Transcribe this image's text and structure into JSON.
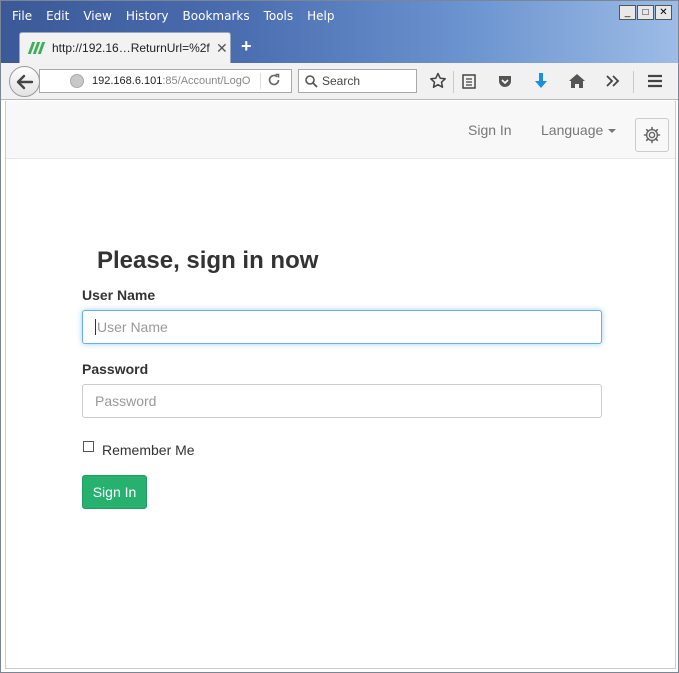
{
  "browser": {
    "menu": [
      "File",
      "Edit",
      "View",
      "History",
      "Bookmarks",
      "Tools",
      "Help"
    ],
    "menu_access_keys": [
      "F",
      "E",
      "V",
      "S",
      "B",
      "T",
      "H"
    ],
    "tab_title": "http://192.16…ReturnUrl=%2f",
    "tab_close": "✕",
    "new_tab": "+",
    "url_host": "192.168.6.101",
    "url_rest": ":85/Account/LogO",
    "search_placeholder": "Search",
    "window_controls": [
      "_",
      "□",
      "✕"
    ]
  },
  "site_nav": {
    "sign_in_link": "Sign In",
    "language_label": "Language"
  },
  "login": {
    "heading": "Please, sign in now",
    "username_label": "User Name",
    "username_placeholder": "User Name",
    "password_label": "Password",
    "password_placeholder": "Password",
    "remember_label": "Remember Me",
    "submit_label": "Sign In"
  },
  "colors": {
    "primary_button": "#26b16f",
    "focus_border": "#66afe9"
  }
}
